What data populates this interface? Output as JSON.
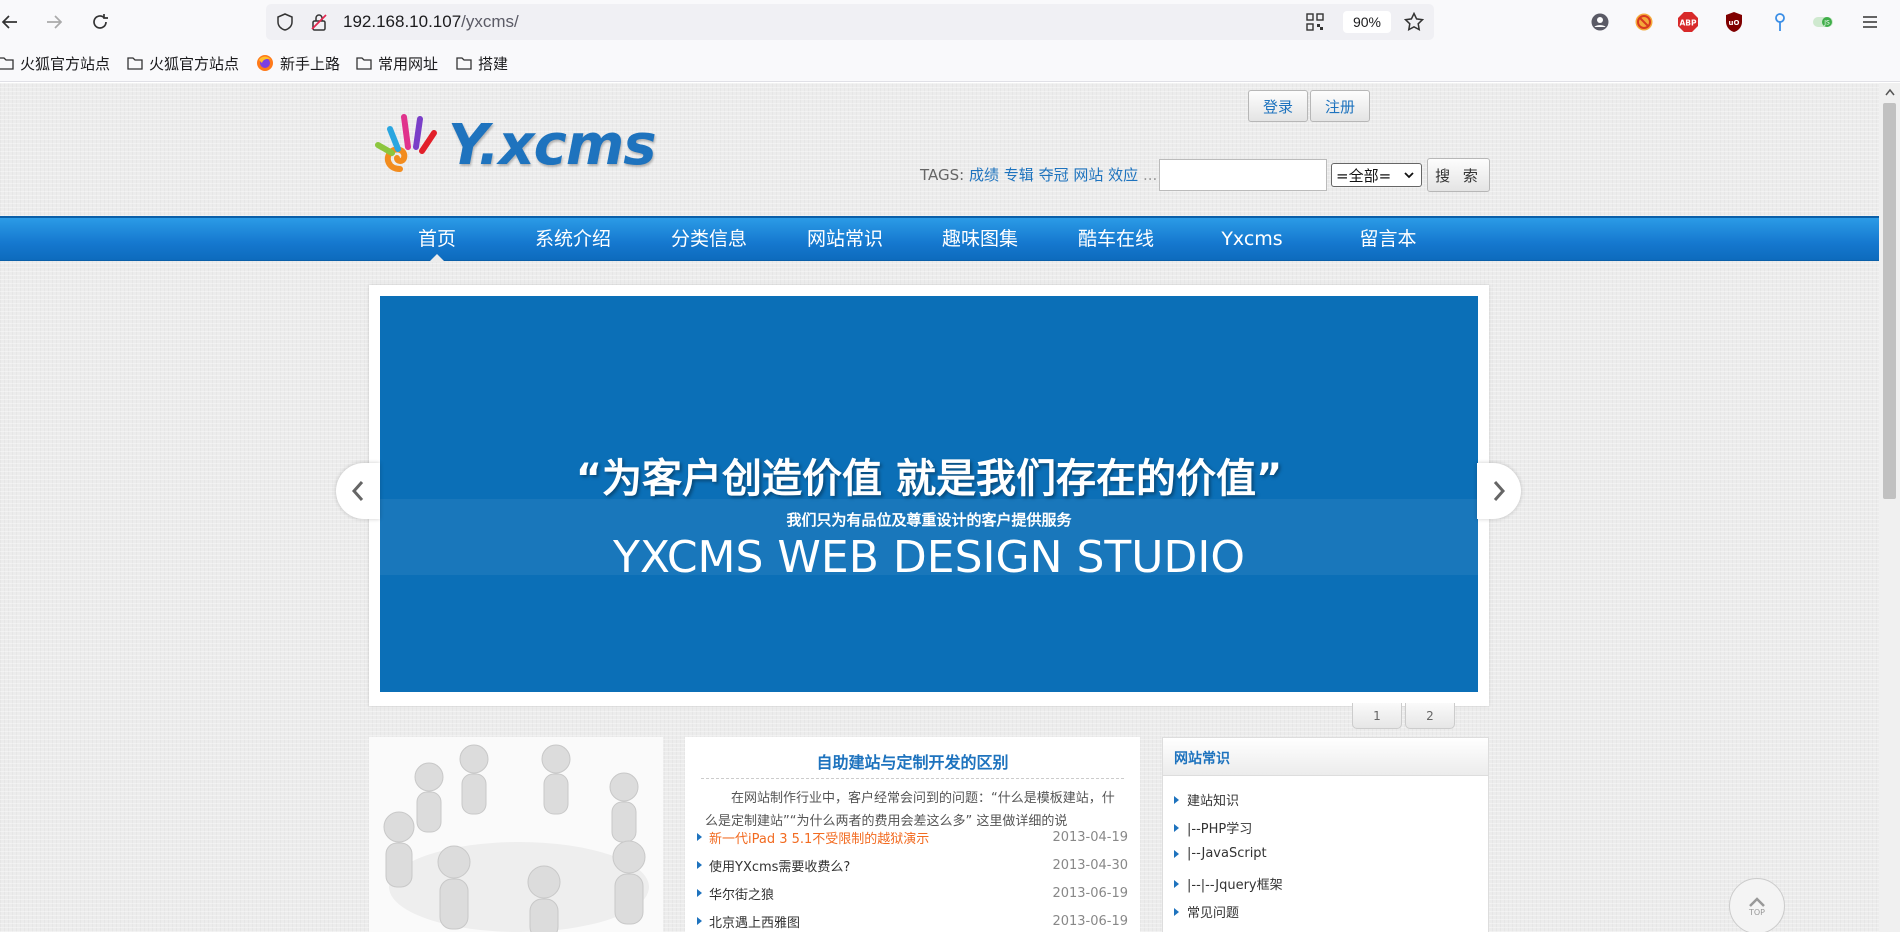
{
  "browser": {
    "url_host": "192.168.10.107",
    "url_path": "/yxcms/",
    "zoom": "90%",
    "bookmarks": [
      "火狐官方站点",
      "火狐官方站点",
      "新手上路",
      "常用网址",
      "搭建"
    ],
    "extensions": [
      "account-icon",
      "block-icon",
      "adblock-plus-icon",
      "ublock-icon",
      "pin-icon",
      "js-toggle-icon"
    ]
  },
  "header": {
    "logo_text": "Y.xcms",
    "login_label": "登录",
    "register_label": "注册",
    "tags_label": "TAGS:",
    "tags": [
      "成绩",
      "专辑",
      "夺冠",
      "网站",
      "效应"
    ],
    "tags_more": "...",
    "search_placeholder": "",
    "search_select": "=全部=",
    "search_button": "搜 索"
  },
  "nav": [
    "首页",
    "系统介绍",
    "分类信息",
    "网站常识",
    "趣味图集",
    "酷车在线",
    "Yxcms",
    "留言本"
  ],
  "banner": {
    "quote": "“为客户创造价值  就是我们存在的价值”",
    "subtitle": "我们只为有品位及尊重设计的客户提供服务",
    "studio": "YXCMS WEB DESIGN STUDIO",
    "pages": [
      "1",
      "2"
    ]
  },
  "news": {
    "title": "自助建站与定制开发的区别",
    "desc": "在网站制作行业中，客户经常会问到的问题：“什么是模板建站，什么是定制建站”“为什么两者的费用会差这么多” 这里做详细的说",
    "items": [
      {
        "title": "新一代iPad 3 5.1不受限制的越狱演示",
        "date": "2013-04-19",
        "hot": true
      },
      {
        "title": "使用YXcms需要收费么?",
        "date": "2013-04-30",
        "hot": false
      },
      {
        "title": "华尔街之狼",
        "date": "2013-06-19",
        "hot": false
      },
      {
        "title": "北京遇上西雅图",
        "date": "2013-06-19",
        "hot": false
      }
    ]
  },
  "sidebar": {
    "title": "网站常识",
    "items": [
      "建站知识",
      "|--PHP学习",
      "|--JavaScript",
      "|--|--Jquery框架",
      "常见问题"
    ]
  },
  "top_button": "TOP",
  "colors": {
    "accent": "#1e73be",
    "nav_bg": "#1578cf",
    "banner_bg": "#0b6fb7",
    "hot_link": "#f26b21"
  }
}
